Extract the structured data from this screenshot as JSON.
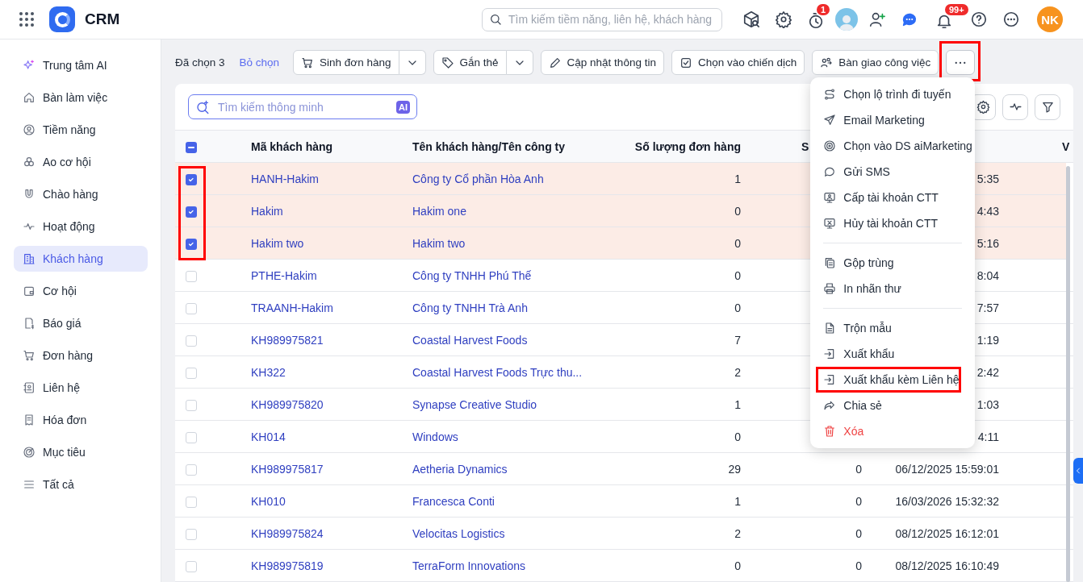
{
  "app": {
    "title": "CRM",
    "search_placeholder": "Tìm kiếm tiềm năng, liên hệ, khách hàng",
    "reminder_badge": "1",
    "notification_badge": "99+",
    "user_initials": "NK"
  },
  "sidebar": {
    "items": [
      {
        "label": "Trung tâm AI",
        "kind": "sparkle",
        "selected": false
      },
      {
        "label": "Bàn làm việc",
        "kind": "home",
        "selected": false
      },
      {
        "label": "Tiềm năng",
        "kind": "person",
        "selected": false
      },
      {
        "label": "Ao cơ hội",
        "kind": "circles",
        "selected": false
      },
      {
        "label": "Chào hàng",
        "kind": "magnet",
        "selected": false
      },
      {
        "label": "Hoạt động",
        "kind": "pulse",
        "selected": false
      },
      {
        "label": "Khách hàng",
        "kind": "building",
        "selected": true
      },
      {
        "label": "Cơ hội",
        "kind": "wallet",
        "selected": false
      },
      {
        "label": "Báo giá",
        "kind": "quote",
        "selected": false
      },
      {
        "label": "Đơn hàng",
        "kind": "cart",
        "selected": false
      },
      {
        "label": "Liên hệ",
        "kind": "contact",
        "selected": false
      },
      {
        "label": "Hóa đơn",
        "kind": "receipt",
        "selected": false
      },
      {
        "label": "Mục tiêu",
        "kind": "target",
        "selected": false
      },
      {
        "label": "Tất cả",
        "kind": "menu",
        "selected": false
      }
    ]
  },
  "action_bar": {
    "selection_text": "Đã chọn 3",
    "clear_link": "Bỏ chọn",
    "actions": [
      {
        "label": "Sinh đơn hàng",
        "kind": "cart",
        "has_dropdown": true
      },
      {
        "label": "Gắn thẻ",
        "kind": "tag",
        "has_dropdown": true
      },
      {
        "label": "Cập nhật thông tin",
        "kind": "pencil",
        "has_dropdown": false
      },
      {
        "label": "Chọn vào chiến dịch",
        "kind": "checkbox",
        "has_dropdown": false
      },
      {
        "label": "Bàn giao công việc",
        "kind": "handover",
        "has_dropdown": false
      }
    ],
    "more_button": {
      "highlighted": true,
      "expanded": true
    }
  },
  "more_menu": {
    "groups": [
      [
        {
          "label": "Chọn lộ trình đi tuyến",
          "kind": "route",
          "danger": false,
          "highlighted": false
        },
        {
          "label": "Email Marketing",
          "kind": "send",
          "danger": false,
          "highlighted": false
        },
        {
          "label": "Chọn vào DS aiMarketing",
          "kind": "ring",
          "danger": false,
          "highlighted": false
        },
        {
          "label": "Gửi SMS",
          "kind": "chat",
          "danger": false,
          "highlighted": false
        },
        {
          "label": "Cấp tài khoản CTT",
          "kind": "monitor-user",
          "danger": false,
          "highlighted": false
        },
        {
          "label": "Hủy tài khoản CTT",
          "kind": "monitor-x",
          "danger": false,
          "highlighted": false
        }
      ],
      [
        {
          "label": "Gộp trùng",
          "kind": "copy",
          "danger": false,
          "highlighted": false
        },
        {
          "label": "In nhãn thư",
          "kind": "printer",
          "danger": false,
          "highlighted": false
        }
      ],
      [
        {
          "label": "Trộn mẫu",
          "kind": "file",
          "danger": false,
          "highlighted": false
        },
        {
          "label": "Xuất khẩu",
          "kind": "export",
          "danger": false,
          "highlighted": false
        },
        {
          "label": "Xuất khẩu kèm Liên hệ",
          "kind": "export",
          "danger": false,
          "highlighted": true
        },
        {
          "label": "Chia sẻ",
          "kind": "share",
          "danger": false,
          "highlighted": false
        },
        {
          "label": "Xóa",
          "kind": "trash",
          "danger": true,
          "highlighted": false
        }
      ]
    ]
  },
  "table": {
    "search_placeholder": "Tìm kiếm thông minh",
    "ai_badge": "AI",
    "header_checkbox": {
      "indeterminate": true
    },
    "checkbox_column_highlighted": true,
    "columns": {
      "code": "Mã khách hàng",
      "name": "Tên khách hàng/Tên công ty",
      "order_count": "Số lượng đơn hàng",
      "column_5": "S",
      "column_7": "V"
    },
    "rows": [
      {
        "checked": true,
        "code": "HANH-Hakim",
        "name": "Công ty Cổ phần Hòa Anh",
        "order_count": "1",
        "column_6": "5:35"
      },
      {
        "checked": true,
        "code": "Hakim",
        "name": "Hakim one",
        "order_count": "0",
        "column_6": "4:43"
      },
      {
        "checked": true,
        "code": "Hakim two",
        "name": "Hakim two",
        "order_count": "0",
        "column_6": "5:16"
      },
      {
        "checked": false,
        "code": "PTHE-Hakim",
        "name": "Công ty TNHH Phú Thế",
        "order_count": "0",
        "column_6": "8:04"
      },
      {
        "checked": false,
        "code": "TRAANH-Hakim",
        "name": "Công ty TNHH Trà Anh",
        "order_count": "0",
        "column_6": "7:57"
      },
      {
        "checked": false,
        "code": "KH989975821",
        "name": "Coastal Harvest Foods",
        "order_count": "7",
        "column_6": "1:19"
      },
      {
        "checked": false,
        "code": "KH322",
        "name": "Coastal Harvest Foods Trực thu...",
        "order_count": "2",
        "column_6": "2:42"
      },
      {
        "checked": false,
        "code": "KH989975820",
        "name": "Synapse Creative Studio",
        "order_count": "1",
        "column_6": "1:03"
      },
      {
        "checked": false,
        "code": "KH014",
        "name": "Windows",
        "order_count": "0",
        "column_6": "4:11"
      },
      {
        "checked": false,
        "code": "KH989975817",
        "name": "Aetheria Dynamics",
        "order_count": "29",
        "column_5": "0",
        "column_6": "06/12/2025 15:59:01"
      },
      {
        "checked": false,
        "code": "KH010",
        "name": "Francesca Conti",
        "order_count": "1",
        "column_5": "0",
        "column_6": "16/03/2026 15:32:32"
      },
      {
        "checked": false,
        "code": "KH989975824",
        "name": "Velocitas Logistics",
        "order_count": "2",
        "column_5": "0",
        "column_6": "08/12/2025 16:12:01"
      },
      {
        "checked": false,
        "code": "KH989975819",
        "name": "TerraForm Innovations",
        "order_count": "0",
        "column_5": "0",
        "column_6": "08/12/2025 16:10:49"
      }
    ]
  }
}
